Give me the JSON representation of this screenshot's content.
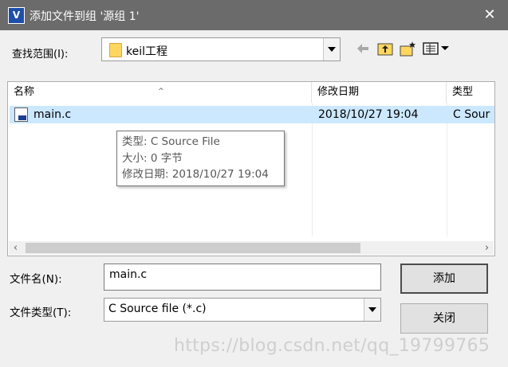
{
  "window": {
    "title": "添加文件到组 '源组 1'",
    "close_glyph": "✕",
    "icon_letter": "V"
  },
  "look_in": {
    "label": "查找范围(I):",
    "value": "keil工程"
  },
  "toolbar": {
    "icons": [
      "back-arrow-icon",
      "up-folder-icon",
      "new-folder-icon",
      "view-menu-icon"
    ]
  },
  "file_list": {
    "columns": [
      "名称",
      "修改日期",
      "类型"
    ],
    "sort_indicator": "^",
    "rows": [
      {
        "name": "main.c",
        "modified": "2018/10/27 19:04",
        "type": "C Sour"
      }
    ],
    "selected_row_color": "#cce8ff"
  },
  "tooltip": {
    "line1": "类型: C Source File",
    "line2": "大小: 0 字节",
    "line3": "修改日期: 2018/10/27 19:04"
  },
  "filename": {
    "label": "文件名(N):",
    "value": "main.c"
  },
  "filetype": {
    "label": "文件类型(T):",
    "value": "C Source file (*.c)"
  },
  "buttons": {
    "add": "添加",
    "close": "关闭"
  },
  "watermark": "https://blog.csdn.net/qq_19799765"
}
